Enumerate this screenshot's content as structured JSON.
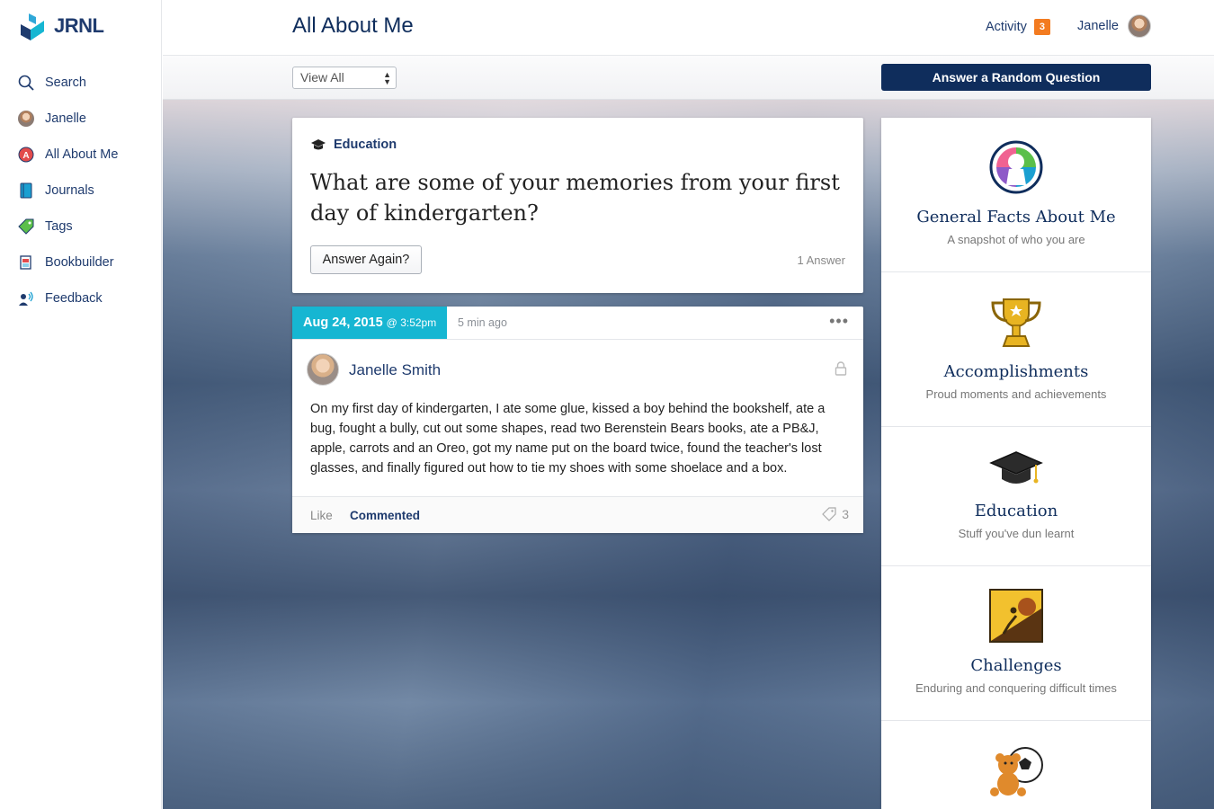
{
  "app": {
    "logo_text": "JRNL"
  },
  "sidebar": {
    "items": [
      {
        "label": "Search",
        "icon": "search-icon"
      },
      {
        "label": "Janelle",
        "icon": "avatar-icon"
      },
      {
        "label": "All About Me",
        "icon": "all-about-me-icon"
      },
      {
        "label": "Journals",
        "icon": "journal-icon"
      },
      {
        "label": "Tags",
        "icon": "tag-icon"
      },
      {
        "label": "Bookbuilder",
        "icon": "book-icon"
      },
      {
        "label": "Feedback",
        "icon": "feedback-icon"
      }
    ]
  },
  "header": {
    "title": "All About Me",
    "activity_label": "Activity",
    "activity_count": "3",
    "user_name": "Janelle"
  },
  "toolbar": {
    "filter_selected": "View All",
    "random_button": "Answer a Random Question"
  },
  "question": {
    "category": "Education",
    "text": "What are some of your memories from your first day of kindergarten?",
    "answer_again": "Answer Again?",
    "answer_count": "1 Answer"
  },
  "entry": {
    "date": "Aug 24, 2015",
    "time": "@ 3:52pm",
    "ago": "5 min ago",
    "more": "•••",
    "author": "Janelle Smith",
    "body": "On my first day of kindergarten, I ate some glue, kissed a boy behind the bookshelf, ate a bug, fought a bully, cut out some shapes, read two Berenstein Bears books, ate a PB&J, apple, carrots and an Oreo, got my name put on the board twice, found the teacher's lost glasses, and finally figured out how to tie my shoes with some shoelace and a box.",
    "like": "Like",
    "commented": "Commented",
    "tag_count": "3"
  },
  "categories": [
    {
      "title": "General Facts About Me",
      "subtitle": "A snapshot of who you are",
      "icon": "general-facts-icon"
    },
    {
      "title": "Accomplishments",
      "subtitle": "Proud moments and achievements",
      "icon": "trophy-icon"
    },
    {
      "title": "Education",
      "subtitle": "Stuff you've dun learnt",
      "icon": "graduation-cap-icon"
    },
    {
      "title": "Challenges",
      "subtitle": "Enduring and conquering difficult times",
      "icon": "challenges-icon"
    },
    {
      "title": "",
      "subtitle": "",
      "icon": "teddy-bear-ball-icon"
    }
  ],
  "colors": {
    "navy": "#0f2d5c",
    "accent_cyan": "#16b6d2",
    "badge_orange": "#f37b20"
  }
}
